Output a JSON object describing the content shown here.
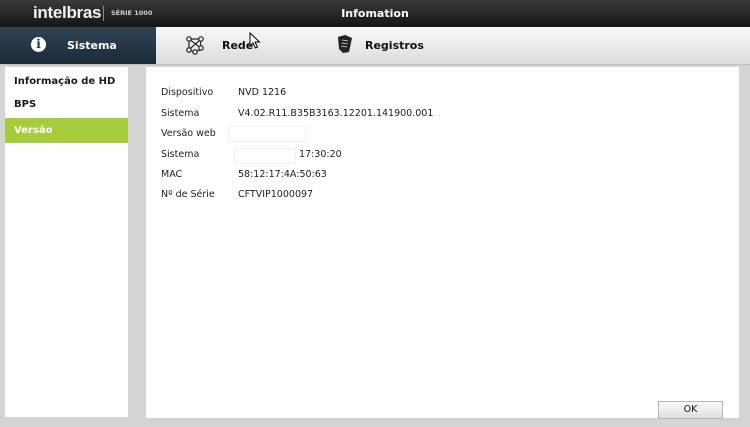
{
  "header": {
    "brand": "intelbras",
    "series": "SÉRIE 1000",
    "window_title": "Infomation"
  },
  "tabs": [
    {
      "label": "Sistema",
      "icon": "info-icon",
      "active": true
    },
    {
      "label": "Rede",
      "icon": "network-icon",
      "active": false
    },
    {
      "label": "Registros",
      "icon": "log-icon",
      "active": false
    }
  ],
  "sidebar": {
    "items": [
      {
        "label": "Informação de HD",
        "active": false
      },
      {
        "label": "BPS",
        "active": false
      },
      {
        "label": "Versão",
        "active": true
      }
    ]
  },
  "version_info": {
    "rows": [
      {
        "key": "Dispositivo",
        "value": "NVD 1216"
      },
      {
        "key": "Sistema",
        "value": "V4.02.R11.B35B3163.12201.141900.001"
      },
      {
        "key": "Versão web",
        "value": ""
      },
      {
        "key": "Sistema",
        "value": "17:30:20"
      },
      {
        "key": "MAC",
        "value": "58:12:17:4A:50:63"
      },
      {
        "key": "Nº de Série",
        "value": "CFTVIP1000097"
      }
    ]
  },
  "buttons": {
    "ok": "OK"
  },
  "colors": {
    "accent": "#a7cc3b",
    "active_tab": "#243545",
    "titlebar": "#1e1e1e"
  }
}
